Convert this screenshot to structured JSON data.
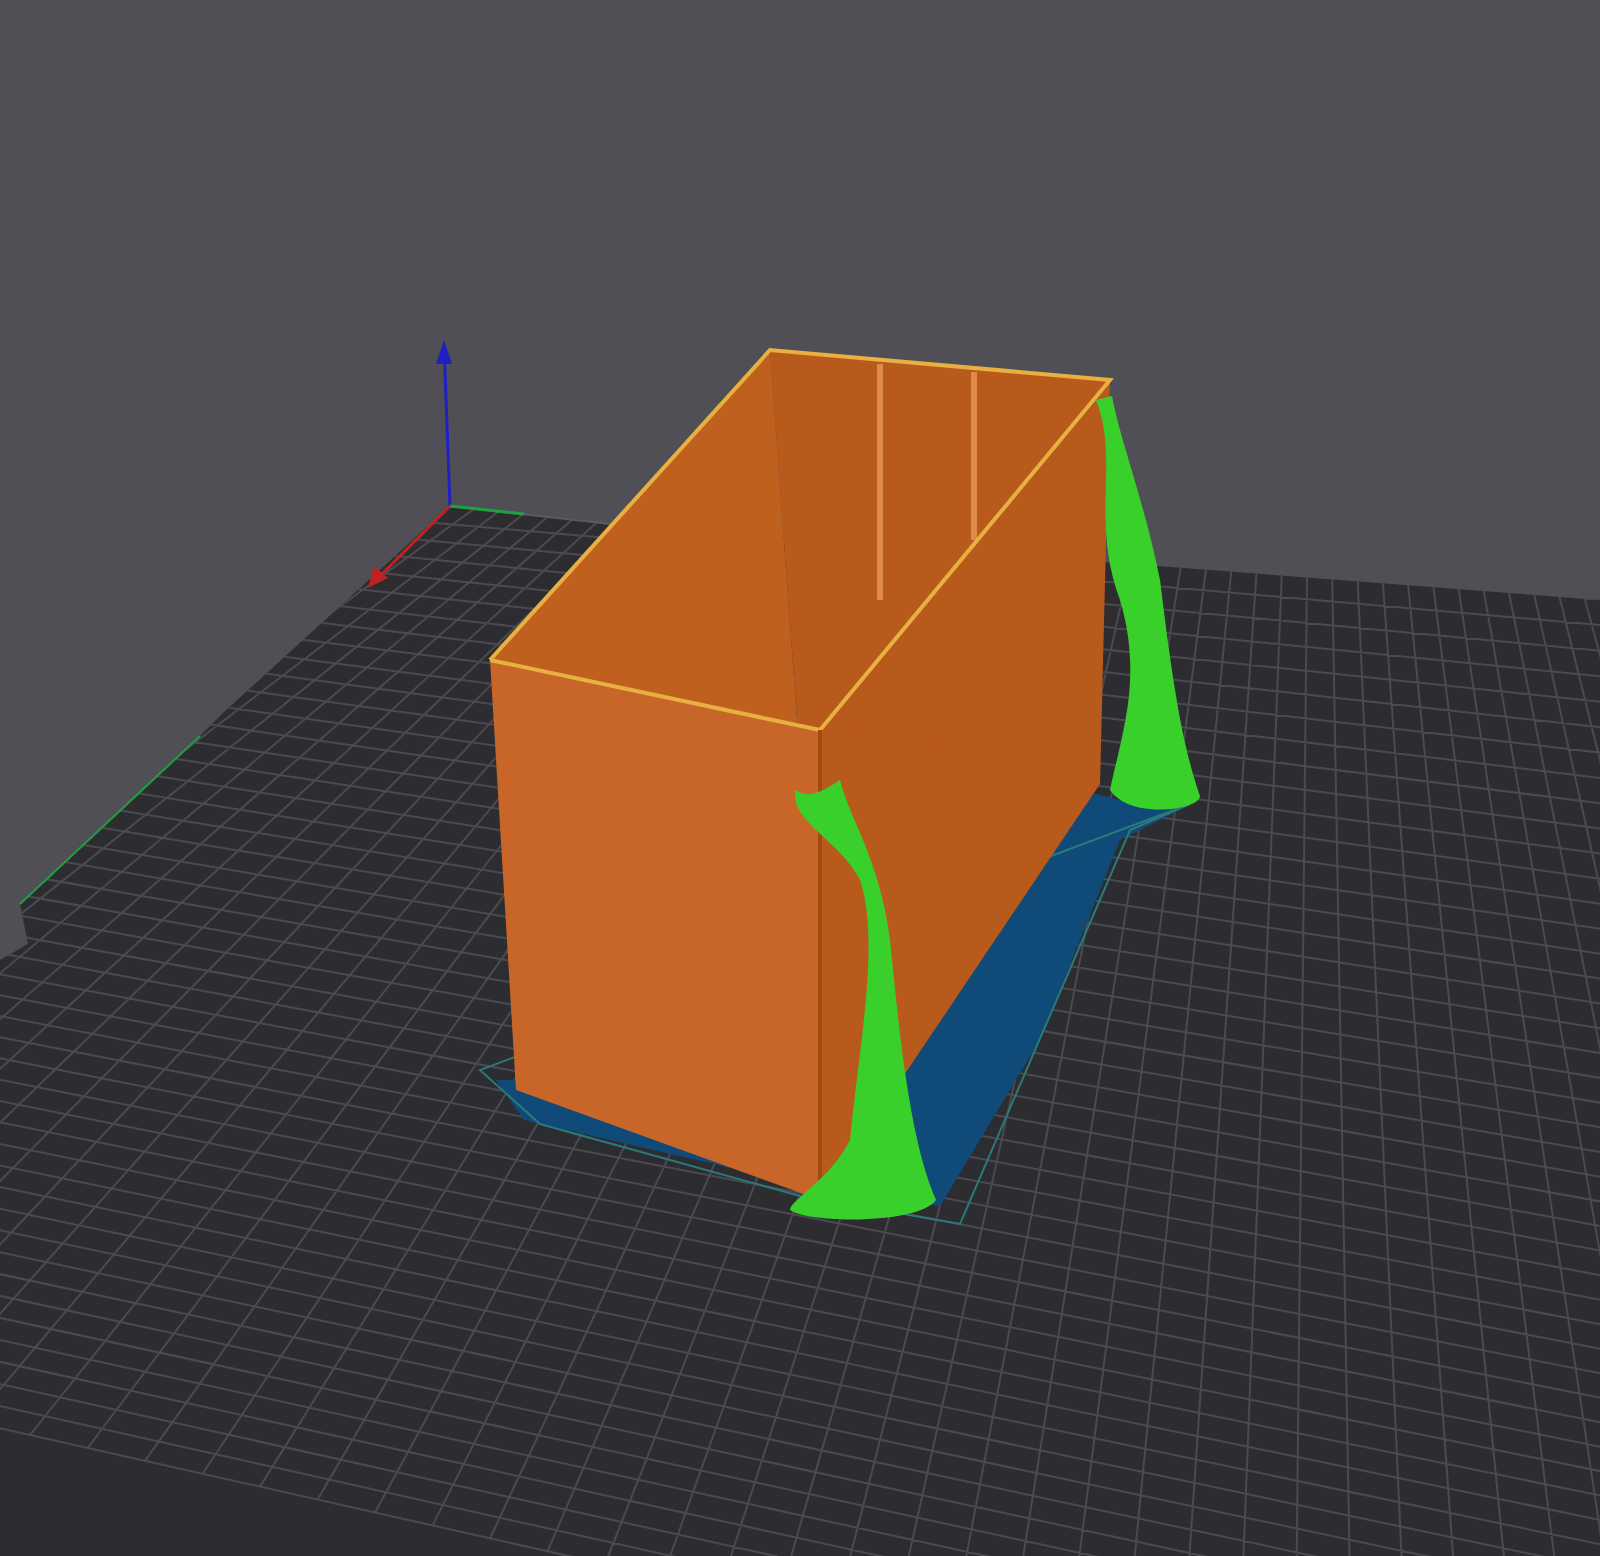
{
  "viewport": {
    "kind": "slicer-preview"
  }
}
